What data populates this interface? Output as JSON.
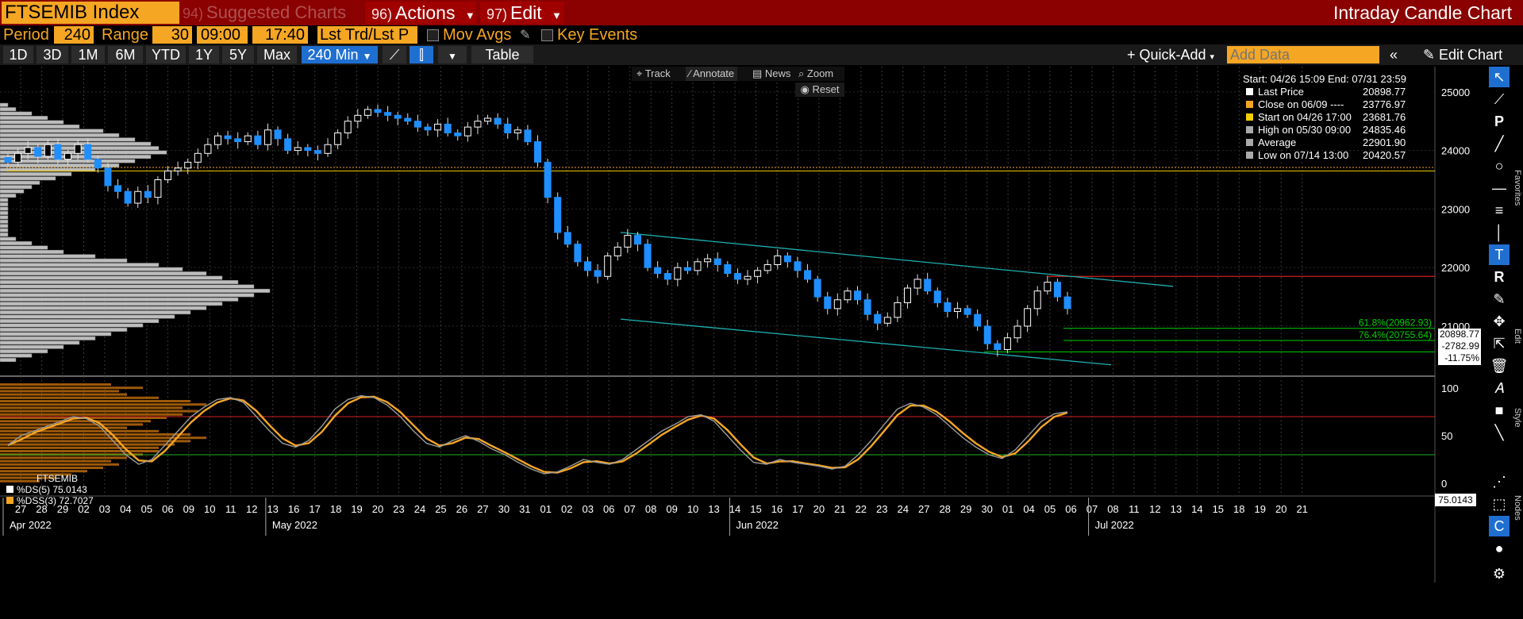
{
  "header": {
    "ticker": "FTSEMIB Index",
    "suggested_num": "94)",
    "suggested_label": "Suggested Charts",
    "actions_num": "96)",
    "actions_label": "Actions",
    "edit_num": "97)",
    "edit_label": "Edit",
    "chart_title": "Intraday Candle Chart"
  },
  "controls": {
    "period_label": "Period",
    "period_value": "240",
    "range_label": "Range",
    "range_value": "30",
    "time_start": "09:00",
    "time_end": "17:40",
    "price_field": "Lst Trd/Lst P",
    "mov_avgs": "Mov Avgs",
    "key_events": "Key Events"
  },
  "toolbar": {
    "range_buttons": [
      "1D",
      "3D",
      "1M",
      "6M",
      "YTD",
      "1Y",
      "5Y",
      "Max"
    ],
    "interval": "240 Min",
    "table_label": "Table",
    "quick_add": "Quick-Add",
    "add_data_placeholder": "Add Data",
    "edit_chart": "Edit Chart"
  },
  "chart_controls": {
    "track": "Track",
    "annotate": "Annotate",
    "news": "News",
    "zoom": "Zoom",
    "reset": "Reset"
  },
  "legend": {
    "header": "Start: 04/26 15:09 End: 07/31 23:59",
    "rows": [
      {
        "label": "Last Price",
        "value": "20898.77",
        "color": "#ffffff"
      },
      {
        "label": "Close on 06/09 ----",
        "value": "23776.97",
        "color": "#f5a623"
      },
      {
        "label": "Start on 04/26 17:00",
        "value": "23681.76",
        "color": "#f5d000"
      },
      {
        "label": "High on 05/30 09:00",
        "value": "24835.46",
        "color": "#aaaaaa"
      },
      {
        "label": "Average",
        "value": "22901.90",
        "color": "#aaaaaa"
      },
      {
        "label": "Low on 07/14 13:00",
        "value": "20420.57",
        "color": "#aaaaaa"
      }
    ]
  },
  "chart_data": {
    "type": "candlestick",
    "main_axis": {
      "ticks": [
        "25000",
        "24000",
        "23000",
        "22000",
        "21000"
      ]
    },
    "fib_levels": [
      {
        "label": "61.8%(20962.93)",
        "value": 20962.93,
        "color": "#00d000"
      },
      {
        "label": "76.4%(20755.64)",
        "value": 20755.64,
        "color": "#00d000"
      }
    ],
    "price_flag": {
      "price": "20898.77",
      "change": "-2782.99",
      "pct": "-11.75%"
    },
    "red_level": 21850,
    "green_level": 20560,
    "closes": [
      23800,
      23950,
      24050,
      23900,
      24100,
      23850,
      23950,
      24100,
      23850,
      23700,
      23400,
      23300,
      23100,
      23300,
      23200,
      23500,
      23650,
      23700,
      23800,
      23950,
      24100,
      24250,
      24200,
      24150,
      24250,
      24100,
      24350,
      24200,
      24000,
      24050,
      24000,
      23950,
      24100,
      24300,
      24500,
      24600,
      24700,
      24650,
      24600,
      24550,
      24500,
      24400,
      24350,
      24450,
      24300,
      24250,
      24400,
      24500,
      24550,
      24450,
      24300,
      24350,
      24150,
      23800,
      23200,
      22600,
      22400,
      22100,
      21950,
      21850,
      22200,
      22350,
      22550,
      22400,
      22000,
      21900,
      21800,
      22000,
      21950,
      22100,
      22150,
      22050,
      21900,
      21800,
      21850,
      21950,
      22050,
      22200,
      22100,
      21950,
      21800,
      21500,
      21300,
      21450,
      21600,
      21450,
      21200,
      21050,
      21150,
      21400,
      21650,
      21800,
      21600,
      21400,
      21250,
      21300,
      21200,
      21000,
      20700,
      20600,
      20800,
      21000,
      21300,
      21600,
      21750,
      21500,
      21300
    ],
    "stoch": {
      "label": "FTSEMIB",
      "ds_label": "%DS(5)",
      "ds_value": "75.0143",
      "dss_label": "%DSS(3)",
      "dss_value": "72.7027",
      "flag_value": "75.0143",
      "ticks": [
        "100",
        "50",
        "0"
      ],
      "upper": 70,
      "lower": 30,
      "values": [
        40,
        50,
        55,
        60,
        65,
        70,
        68,
        60,
        45,
        30,
        20,
        25,
        40,
        55,
        70,
        80,
        88,
        90,
        85,
        70,
        55,
        42,
        38,
        45,
        60,
        78,
        88,
        92,
        90,
        82,
        70,
        55,
        42,
        38,
        45,
        50,
        44,
        36,
        30,
        22,
        15,
        10,
        12,
        18,
        25,
        22,
        20,
        25,
        35,
        45,
        55,
        62,
        70,
        72,
        65,
        50,
        35,
        22,
        20,
        25,
        22,
        20,
        18,
        15,
        18,
        30,
        45,
        62,
        78,
        84,
        80,
        72,
        60,
        48,
        38,
        30,
        26,
        35,
        50,
        65,
        73,
        75
      ]
    },
    "x_ticks": [
      {
        "label": "27",
        "r": 0.01
      },
      {
        "label": "28",
        "r": 0.022
      },
      {
        "label": "29",
        "r": 0.034
      },
      {
        "label": "02",
        "r": 0.046
      },
      {
        "label": "03",
        "r": 0.058
      },
      {
        "label": "04",
        "r": 0.07
      },
      {
        "label": "05",
        "r": 0.082
      },
      {
        "label": "06",
        "r": 0.094
      },
      {
        "label": "09",
        "r": 0.106
      },
      {
        "label": "10",
        "r": 0.118
      },
      {
        "label": "11",
        "r": 0.13
      },
      {
        "label": "12",
        "r": 0.142
      },
      {
        "label": "13",
        "r": 0.154
      },
      {
        "label": "16",
        "r": 0.166
      },
      {
        "label": "17",
        "r": 0.178
      },
      {
        "label": "18",
        "r": 0.19
      },
      {
        "label": "19",
        "r": 0.202
      },
      {
        "label": "20",
        "r": 0.214
      },
      {
        "label": "23",
        "r": 0.226
      },
      {
        "label": "24",
        "r": 0.238
      },
      {
        "label": "25",
        "r": 0.25
      },
      {
        "label": "26",
        "r": 0.262
      },
      {
        "label": "27",
        "r": 0.274
      },
      {
        "label": "30",
        "r": 0.286
      },
      {
        "label": "31",
        "r": 0.298
      },
      {
        "label": "01",
        "r": 0.31
      },
      {
        "label": "02",
        "r": 0.322
      },
      {
        "label": "03",
        "r": 0.334
      },
      {
        "label": "06",
        "r": 0.346
      },
      {
        "label": "07",
        "r": 0.358
      },
      {
        "label": "08",
        "r": 0.37
      },
      {
        "label": "09",
        "r": 0.382
      },
      {
        "label": "10",
        "r": 0.394
      },
      {
        "label": "13",
        "r": 0.406
      },
      {
        "label": "14",
        "r": 0.418
      },
      {
        "label": "15",
        "r": 0.43
      },
      {
        "label": "16",
        "r": 0.442
      },
      {
        "label": "17",
        "r": 0.454
      },
      {
        "label": "20",
        "r": 0.466
      },
      {
        "label": "21",
        "r": 0.478
      },
      {
        "label": "22",
        "r": 0.49
      },
      {
        "label": "23",
        "r": 0.502
      },
      {
        "label": "24",
        "r": 0.514
      },
      {
        "label": "27",
        "r": 0.526
      },
      {
        "label": "28",
        "r": 0.538
      },
      {
        "label": "29",
        "r": 0.55
      },
      {
        "label": "30",
        "r": 0.562
      },
      {
        "label": "01",
        "r": 0.574
      },
      {
        "label": "04",
        "r": 0.586
      },
      {
        "label": "05",
        "r": 0.598
      },
      {
        "label": "06",
        "r": 0.61
      },
      {
        "label": "07",
        "r": 0.622
      },
      {
        "label": "08",
        "r": 0.634
      },
      {
        "label": "11",
        "r": 0.646
      },
      {
        "label": "12",
        "r": 0.658
      },
      {
        "label": "13",
        "r": 0.67
      },
      {
        "label": "14",
        "r": 0.682
      },
      {
        "label": "15",
        "r": 0.694
      },
      {
        "label": "18",
        "r": 0.706
      },
      {
        "label": "19",
        "r": 0.718
      },
      {
        "label": "20",
        "r": 0.73
      },
      {
        "label": "21",
        "r": 0.742
      }
    ],
    "months": [
      {
        "label": "Apr 2022",
        "r": 0.0
      },
      {
        "label": "May 2022",
        "r": 0.15
      },
      {
        "label": "Jun 2022",
        "r": 0.415
      },
      {
        "label": "Jul 2022",
        "r": 0.62
      }
    ]
  },
  "side_labels": {
    "favorites": "Favorites",
    "edit": "Edit",
    "style": "Style",
    "nodes": "Nodes"
  },
  "colors": {
    "accent": "#f5a623",
    "up_candle": "#ffffff",
    "down_candle": "#1f8fff",
    "red_line": "#d02020",
    "green_line": "#20b020",
    "trend": "#1fb0b0"
  }
}
